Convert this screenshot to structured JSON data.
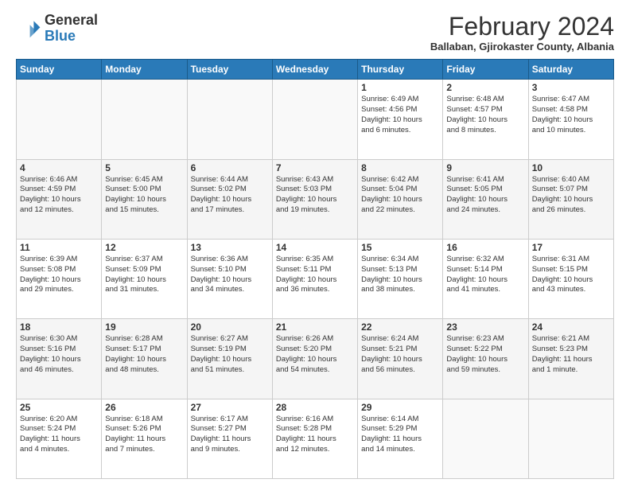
{
  "logo": {
    "general": "General",
    "blue": "Blue"
  },
  "title": "February 2024",
  "subtitle": "Ballaban, Gjirokaster County, Albania",
  "days_of_week": [
    "Sunday",
    "Monday",
    "Tuesday",
    "Wednesday",
    "Thursday",
    "Friday",
    "Saturday"
  ],
  "weeks": [
    [
      {
        "day": "",
        "info": ""
      },
      {
        "day": "",
        "info": ""
      },
      {
        "day": "",
        "info": ""
      },
      {
        "day": "",
        "info": ""
      },
      {
        "day": "1",
        "info": "Sunrise: 6:49 AM\nSunset: 4:56 PM\nDaylight: 10 hours\nand 6 minutes."
      },
      {
        "day": "2",
        "info": "Sunrise: 6:48 AM\nSunset: 4:57 PM\nDaylight: 10 hours\nand 8 minutes."
      },
      {
        "day": "3",
        "info": "Sunrise: 6:47 AM\nSunset: 4:58 PM\nDaylight: 10 hours\nand 10 minutes."
      }
    ],
    [
      {
        "day": "4",
        "info": "Sunrise: 6:46 AM\nSunset: 4:59 PM\nDaylight: 10 hours\nand 12 minutes."
      },
      {
        "day": "5",
        "info": "Sunrise: 6:45 AM\nSunset: 5:00 PM\nDaylight: 10 hours\nand 15 minutes."
      },
      {
        "day": "6",
        "info": "Sunrise: 6:44 AM\nSunset: 5:02 PM\nDaylight: 10 hours\nand 17 minutes."
      },
      {
        "day": "7",
        "info": "Sunrise: 6:43 AM\nSunset: 5:03 PM\nDaylight: 10 hours\nand 19 minutes."
      },
      {
        "day": "8",
        "info": "Sunrise: 6:42 AM\nSunset: 5:04 PM\nDaylight: 10 hours\nand 22 minutes."
      },
      {
        "day": "9",
        "info": "Sunrise: 6:41 AM\nSunset: 5:05 PM\nDaylight: 10 hours\nand 24 minutes."
      },
      {
        "day": "10",
        "info": "Sunrise: 6:40 AM\nSunset: 5:07 PM\nDaylight: 10 hours\nand 26 minutes."
      }
    ],
    [
      {
        "day": "11",
        "info": "Sunrise: 6:39 AM\nSunset: 5:08 PM\nDaylight: 10 hours\nand 29 minutes."
      },
      {
        "day": "12",
        "info": "Sunrise: 6:37 AM\nSunset: 5:09 PM\nDaylight: 10 hours\nand 31 minutes."
      },
      {
        "day": "13",
        "info": "Sunrise: 6:36 AM\nSunset: 5:10 PM\nDaylight: 10 hours\nand 34 minutes."
      },
      {
        "day": "14",
        "info": "Sunrise: 6:35 AM\nSunset: 5:11 PM\nDaylight: 10 hours\nand 36 minutes."
      },
      {
        "day": "15",
        "info": "Sunrise: 6:34 AM\nSunset: 5:13 PM\nDaylight: 10 hours\nand 38 minutes."
      },
      {
        "day": "16",
        "info": "Sunrise: 6:32 AM\nSunset: 5:14 PM\nDaylight: 10 hours\nand 41 minutes."
      },
      {
        "day": "17",
        "info": "Sunrise: 6:31 AM\nSunset: 5:15 PM\nDaylight: 10 hours\nand 43 minutes."
      }
    ],
    [
      {
        "day": "18",
        "info": "Sunrise: 6:30 AM\nSunset: 5:16 PM\nDaylight: 10 hours\nand 46 minutes."
      },
      {
        "day": "19",
        "info": "Sunrise: 6:28 AM\nSunset: 5:17 PM\nDaylight: 10 hours\nand 48 minutes."
      },
      {
        "day": "20",
        "info": "Sunrise: 6:27 AM\nSunset: 5:19 PM\nDaylight: 10 hours\nand 51 minutes."
      },
      {
        "day": "21",
        "info": "Sunrise: 6:26 AM\nSunset: 5:20 PM\nDaylight: 10 hours\nand 54 minutes."
      },
      {
        "day": "22",
        "info": "Sunrise: 6:24 AM\nSunset: 5:21 PM\nDaylight: 10 hours\nand 56 minutes."
      },
      {
        "day": "23",
        "info": "Sunrise: 6:23 AM\nSunset: 5:22 PM\nDaylight: 10 hours\nand 59 minutes."
      },
      {
        "day": "24",
        "info": "Sunrise: 6:21 AM\nSunset: 5:23 PM\nDaylight: 11 hours\nand 1 minute."
      }
    ],
    [
      {
        "day": "25",
        "info": "Sunrise: 6:20 AM\nSunset: 5:24 PM\nDaylight: 11 hours\nand 4 minutes."
      },
      {
        "day": "26",
        "info": "Sunrise: 6:18 AM\nSunset: 5:26 PM\nDaylight: 11 hours\nand 7 minutes."
      },
      {
        "day": "27",
        "info": "Sunrise: 6:17 AM\nSunset: 5:27 PM\nDaylight: 11 hours\nand 9 minutes."
      },
      {
        "day": "28",
        "info": "Sunrise: 6:16 AM\nSunset: 5:28 PM\nDaylight: 11 hours\nand 12 minutes."
      },
      {
        "day": "29",
        "info": "Sunrise: 6:14 AM\nSunset: 5:29 PM\nDaylight: 11 hours\nand 14 minutes."
      },
      {
        "day": "",
        "info": ""
      },
      {
        "day": "",
        "info": ""
      }
    ]
  ]
}
